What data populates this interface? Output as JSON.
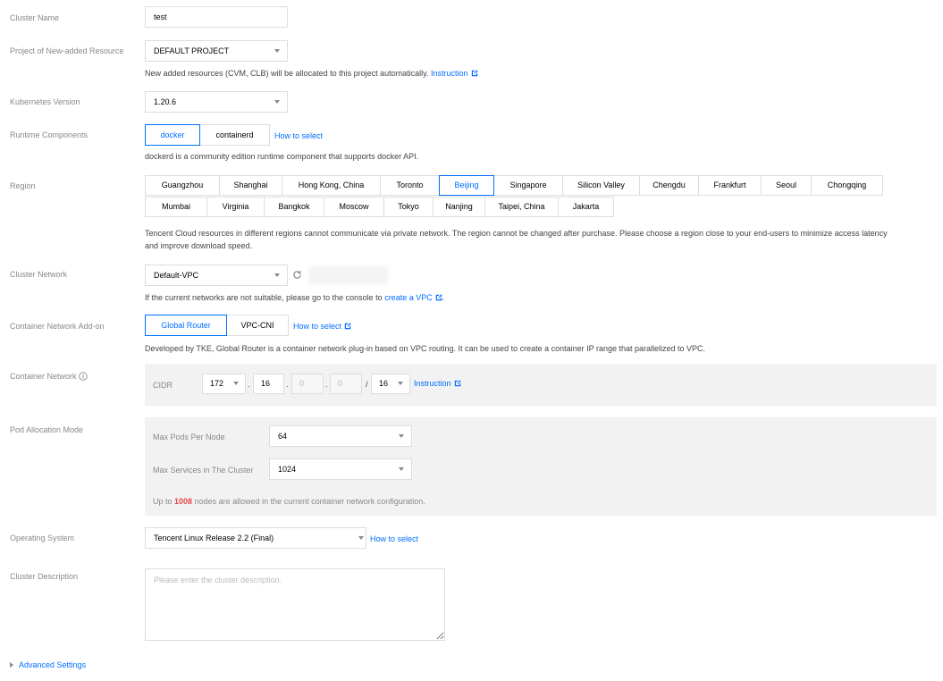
{
  "cluster_name": {
    "label": "Cluster Name",
    "value": "test"
  },
  "project": {
    "label": "Project of New-added Resource",
    "value": "DEFAULT PROJECT",
    "hint": "New added resources (CVM, CLB) will be allocated to this project automatically.",
    "link": "Instruction"
  },
  "k8s": {
    "label": "Kubernetes Version",
    "value": "1.20.6"
  },
  "runtime": {
    "label": "Runtime Components",
    "options": [
      "docker",
      "containerd"
    ],
    "selected": "docker",
    "link": "How to select",
    "hint": "dockerd is a community edition runtime component that supports docker API."
  },
  "region": {
    "label": "Region",
    "row1": [
      "Guangzhou",
      "Shanghai",
      "Hong Kong, China",
      "Toronto",
      "Beijing",
      "Singapore",
      "Silicon Valley",
      "Chengdu",
      "Frankfurt",
      "Seoul",
      "Chongqing"
    ],
    "row2": [
      "Mumbai",
      "Virginia",
      "Bangkok",
      "Moscow",
      "Tokyo",
      "Nanjing",
      "Taipei, China",
      "Jakarta"
    ],
    "selected": "Beijing",
    "hint_line1": "Tencent Cloud resources in different regions cannot communicate via private network. The region cannot be changed after purchase. Please choose a region close to your end-users to minimize access latency",
    "hint_line2": "and improve download speed."
  },
  "cluster_network": {
    "label": "Cluster Network",
    "value": "Default-VPC",
    "hint_prefix": "If the current networks are not suitable, please go to the console to",
    "link": "create a VPC",
    "hint_suffix": "."
  },
  "addon": {
    "label": "Container Network Add-on",
    "options": [
      "Global Router",
      "VPC-CNI"
    ],
    "selected": "Global Router",
    "link": "How to select",
    "hint": "Developed by TKE, Global Router is a container network plug-in based on VPC routing. It can be used to create a container IP range that parallelized to VPC."
  },
  "container_network": {
    "label": "Container Network",
    "cidr_label": "CIDR",
    "octet1": "172",
    "octet2": "16",
    "octet3": "0",
    "octet4": "0",
    "mask": "16",
    "sep_dot": ".",
    "sep_slash": "/",
    "link": "Instruction"
  },
  "pod_alloc": {
    "label": "Pod Allocation Mode",
    "max_pods_label": "Max Pods Per Node",
    "max_pods_value": "64",
    "max_services_label": "Max Services in The Cluster",
    "max_services_value": "1024",
    "note_prefix": "Up to",
    "note_count": "1008",
    "note_suffix": "nodes are allowed in the current container network configuration."
  },
  "os": {
    "label": "Operating System",
    "value": "Tencent Linux Release 2.2 (Final)",
    "link": "How to select"
  },
  "description": {
    "label": "Cluster Description",
    "placeholder": "Please enter the cluster description."
  },
  "advanced": {
    "label": "Advanced Settings"
  },
  "colors": {
    "accent": "#006eff",
    "highlight": "#e54545",
    "panel": "#f2f2f2"
  }
}
